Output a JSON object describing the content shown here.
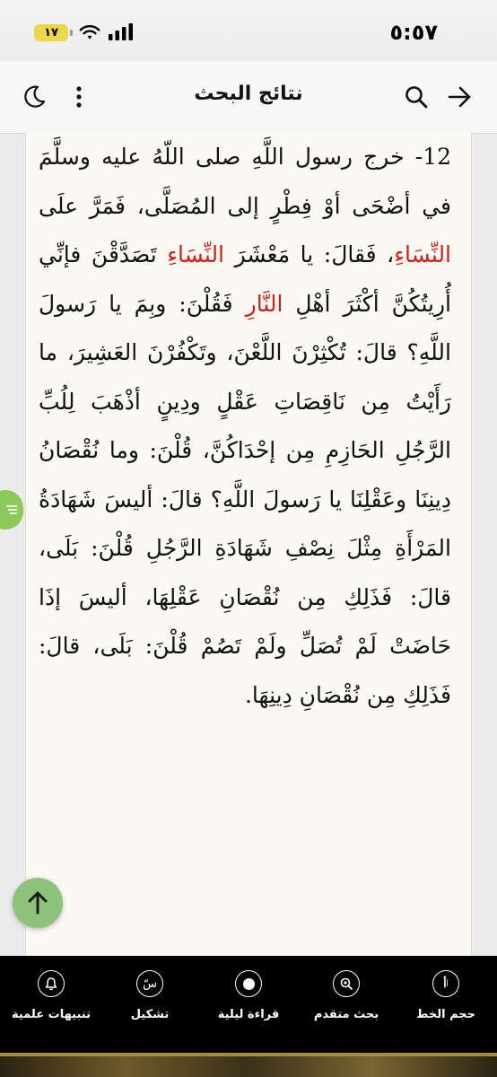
{
  "status": {
    "time": "٥:٥٧",
    "battery": "١٧"
  },
  "header": {
    "title": "نتائج البحث"
  },
  "hadith": {
    "parts": [
      {
        "t": "12- خرج رسول اللَّهِ صلى اللّهُ عليه وسلَّمَ في أضْحَى أوْ فِطْرٍ إلى المُصَلَّى، فَمَرَّ علَى "
      },
      {
        "t": "النِّسَاءِ",
        "hl": true
      },
      {
        "t": "، فَقالَ: يا مَعْشَرَ "
      },
      {
        "t": "النِّسَاءِ",
        "hl": true
      },
      {
        "t": " تَصَدَّقْنَ فإنِّي أُرِيتُكُنَّ أكْثَرَ أهْلِ "
      },
      {
        "t": "النَّارِ",
        "hl": true
      },
      {
        "t": " فَقُلْنَ: وبِمَ يا رَسولَ اللَّهِ؟ قالَ: تُكْثِرْنَ اللَّعْنَ، وتَكْفُرْنَ العَشِيرَ، ما رَأَيْتُ مِن نَاقِصَاتِ عَقْلٍ ودِينٍ أذْهَبَ لِلُبِّ الرَّجُلِ الحَازِمِ مِن إحْدَاكُنَّ، قُلْنَ: وما نُقْصَانُ دِينِنَا وعَقْلِنَا يا رَسولَ اللَّهِ؟ قالَ: أليسَ شَهَادَةُ المَرْأَةِ مِثْلَ نِصْفِ شَهَادَةِ الرَّجُلِ قُلْنَ: بَلَى، قالَ: فَذَلِكِ مِن نُقْصَانِ عَقْلِهَا، أليسَ إذَا حَاضَتْ لَمْ تُصَلِّ ولَمْ تَصُمْ قُلْنَ: بَلَى، قالَ: فَذَلِكِ مِن نُقْصَانِ دِينِهَا."
      }
    ]
  },
  "bottom_bar": {
    "font_size": "حجم الخط",
    "advanced_search": "بحث متقدم",
    "night_reading": "قراءة ليلية",
    "diacritics": "تشكيل",
    "scientific_alerts": "تنبيهات علمية"
  },
  "colors": {
    "highlight": "#c8201c",
    "accent_green": "#8cc85a",
    "page_bg": "#fbf9f4"
  },
  "icons": [
    "back-arrow-icon",
    "search-icon",
    "more-icon",
    "moon-icon",
    "list-icon",
    "arrow-up-icon",
    "font-size-icon",
    "search-advanced-icon",
    "night-reading-icon",
    "diacritics-icon",
    "bell-icon"
  ]
}
